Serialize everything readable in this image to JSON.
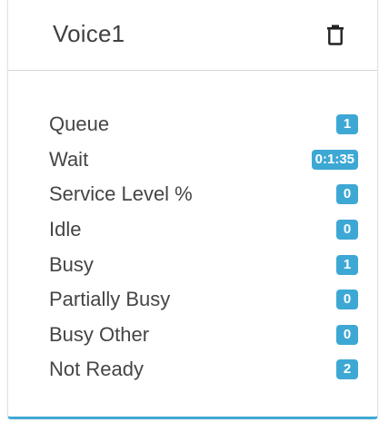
{
  "panel": {
    "title": "Voice1",
    "delete_icon": "trash-icon",
    "accent_color": "#3ea8d5"
  },
  "stats": [
    {
      "label": "Queue",
      "value": "1"
    },
    {
      "label": "Wait",
      "value": "0:1:35"
    },
    {
      "label": "Service Level %",
      "value": "0"
    },
    {
      "label": "Idle",
      "value": "0"
    },
    {
      "label": "Busy",
      "value": "1"
    },
    {
      "label": "Partially Busy",
      "value": "0"
    },
    {
      "label": "Busy Other",
      "value": "0"
    },
    {
      "label": "Not Ready",
      "value": "2"
    }
  ]
}
